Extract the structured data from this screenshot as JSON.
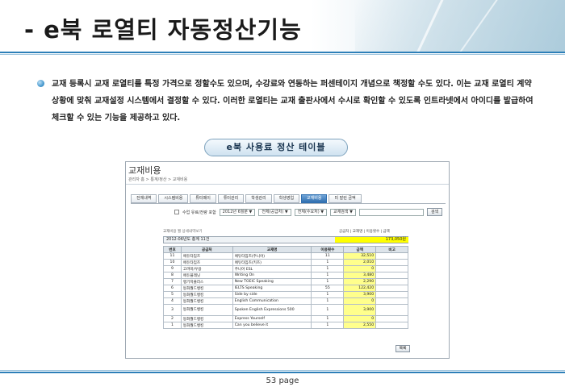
{
  "header": {
    "title": "- e북 로열티 자동정산기능"
  },
  "body": {
    "paragraph": "교재 등록시 교재 로열티를 특정 가격으로 정할수도 있으며, 수강료와 연동하는 퍼센테이지 개념으로 책정할 수도 있다. 이는 교재 로열티 계약 상황에 맞춰 교재설정 시스템에서 결정할 수 있다. 이러한 로열티는 교재 출판사에서 수시로 확인할 수 있도록 인트라넷에서 아이디를 발급하여 체크할 수 있는 기능을 제공하고 있다."
  },
  "caption": "e북 사용료 정산 테이블",
  "screenshot": {
    "title": "교재비용",
    "breadcrumb": "관리자 홈 > 통계/정산 > 교재비용",
    "tabs": [
      "전체내역",
      "시스템비용",
      "튜터페이",
      "튜터관리",
      "학생관리",
      "학생영업",
      "교재비용",
      "미 발린 금액"
    ],
    "active_tab_index": 6,
    "filter": {
      "checkbox_label": "수업 유료/전량 포함",
      "period": "2012년 6월분 ▼",
      "vendor": "전체(공급처) ▼",
      "type": "전체(수요처) ▼",
      "search_select": "교재검색 ▼",
      "search_value": "",
      "search_button": "검색"
    },
    "table_note": "교재비용 월 상세내역보기",
    "table_note_right": "공급처 | 교재명 | 이용횟수 | 금액",
    "summary_label": "2012-06년도 총계 11건",
    "summary_total": "173,050원",
    "columns": [
      "번호",
      "공급처",
      "교재명",
      "이용횟수",
      "금액",
      "비고"
    ],
    "rows": [
      {
        "no": "11",
        "vendor": "에듀타임즈",
        "book": "에듀타임즈(주니어)",
        "count": "11",
        "amount": "32,510",
        "note": ""
      },
      {
        "no": "10",
        "vendor": "에듀타임즈",
        "book": "에듀타임즈(키즈)",
        "count": "1",
        "amount": "2,010",
        "note": ""
      },
      {
        "no": "9",
        "vendor": "고려미/우용",
        "book": "주니어 ESL",
        "count": "1",
        "amount": "0",
        "note": ""
      },
      {
        "no": "8",
        "vendor": "에듀플레닛",
        "book": "Writing On",
        "count": "1",
        "amount": "3,480",
        "note": ""
      },
      {
        "no": "7",
        "vendor": "랭기지플러스",
        "book": "New TOEIC Speaking",
        "count": "1",
        "amount": "2,290",
        "note": ""
      },
      {
        "no": "6",
        "vendor": "동화월드뱅킹",
        "book": "IELTS Speaking",
        "count": "55",
        "amount": "122,420",
        "note": ""
      },
      {
        "no": "5",
        "vendor": "동화월드뱅킹",
        "book": "Side by side",
        "count": "1",
        "amount": "3,900",
        "note": ""
      },
      {
        "no": "4",
        "vendor": "동화월드뱅킹",
        "book": "English Communication",
        "count": "1",
        "amount": "0",
        "note": ""
      },
      {
        "no": "3",
        "vendor": "동화월드뱅킹",
        "book": "Spoken English Expressions 500",
        "count": "1",
        "amount": "3,900",
        "note": ""
      },
      {
        "no": "2",
        "vendor": "동화월드뱅킹",
        "book": "Express Yourself",
        "count": "1",
        "amount": "0",
        "note": ""
      },
      {
        "no": "1",
        "vendor": "동화월드뱅킹",
        "book": "Can you believe it",
        "count": "1",
        "amount": "2,550",
        "note": ""
      }
    ],
    "print_button": "목록"
  },
  "footer": {
    "page": "53 page"
  },
  "colors": {
    "accent": "#2d7fb8",
    "highlight": "#ffff00",
    "amount_cell": "#ffff8c"
  }
}
